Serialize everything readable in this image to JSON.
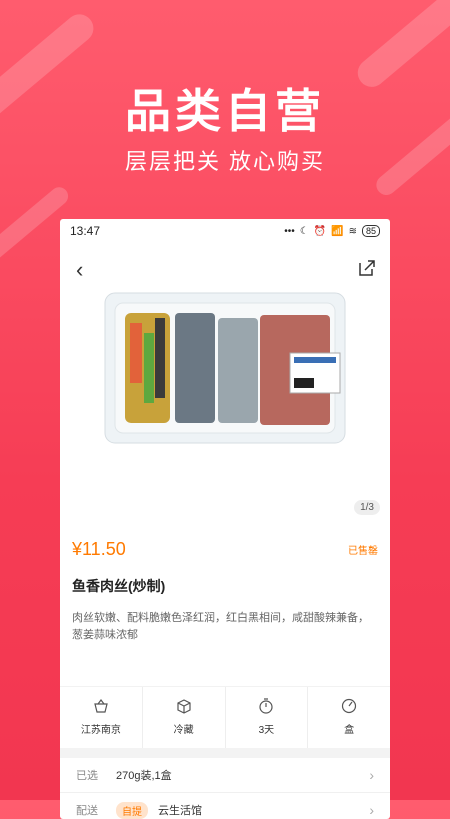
{
  "hero": {
    "title": "品类自营",
    "subtitle": "层层把关 放心购买"
  },
  "status_bar": {
    "time": "13:47",
    "dots": "•••",
    "battery": "85"
  },
  "gallery": {
    "counter": "1/3"
  },
  "product": {
    "price": "¥11.50",
    "sold": "已售罄",
    "name": "鱼香肉丝(炒制)",
    "description": "肉丝软嫩、配料脆嫩色泽红润，红白黑相间，咸甜酸辣兼备，葱姜蒜味浓郁"
  },
  "attributes": [
    {
      "label": "江苏南京",
      "icon": "basket-icon"
    },
    {
      "label": "冷藏",
      "icon": "box-icon"
    },
    {
      "label": "3天",
      "icon": "timer-icon"
    },
    {
      "label": "盒",
      "icon": "gauge-icon"
    }
  ],
  "options": {
    "selected_key": "已选",
    "selected_value": "270g装,1盒",
    "delivery_key": "配送",
    "delivery_tag": "自提",
    "delivery_value": "云生活馆"
  },
  "colors": {
    "brand": "#f63d55",
    "accent": "#ff7a00"
  }
}
